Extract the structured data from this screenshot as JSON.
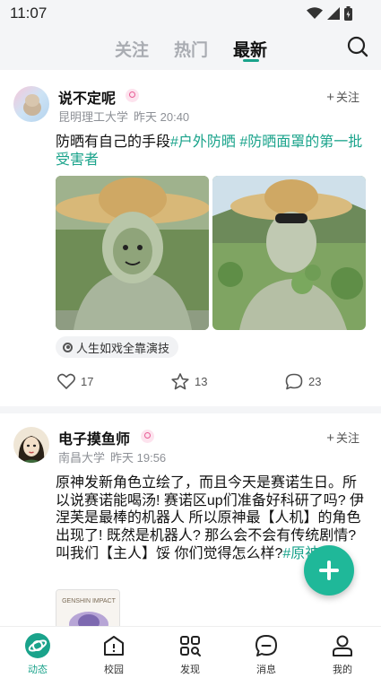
{
  "status_bar": {
    "time": "11:07"
  },
  "top_nav": {
    "tabs": [
      {
        "label": "关注"
      },
      {
        "label": "热门"
      },
      {
        "label": "最新"
      }
    ],
    "active_tab": "最新"
  },
  "posts": [
    {
      "username": "说不定呢",
      "school": "昆明理工大学",
      "time": "昨天 20:40",
      "follow_label": "关注",
      "content_text": "防晒有自己的手段",
      "tags": [
        "#户外防晒",
        "#防晒面罩的第一批受害者"
      ],
      "topic": "人生如戏全靠演技",
      "likes": "17",
      "favorites": "13",
      "comments": "23"
    },
    {
      "username": "电子摸鱼师",
      "school": "南昌大学",
      "time": "昨天 19:56",
      "follow_label": "关注",
      "content_text": "原神发新角色立绘了，而且今天是赛诺生日。所以说赛诺能喝汤! 赛诺区up们准备好科研了吗? 伊涅芙是最棒的机器人 所以原神最【人机】的角色出现了! 既然是机器人? 那么会不会有传统剧情? 叫我们【主人】馁 你们觉得怎么样?",
      "tags": [
        "#原神"
      ],
      "thumb_label": "GENSHIN IMPACT"
    }
  ],
  "bottom_nav": {
    "items": [
      {
        "label": "动态"
      },
      {
        "label": "校园"
      },
      {
        "label": "发现"
      },
      {
        "label": "消息"
      },
      {
        "label": "我的"
      }
    ],
    "active": "动态"
  },
  "colors": {
    "accent": "#1aa38b",
    "fab": "#1fb899",
    "badge": "#e85c95"
  }
}
